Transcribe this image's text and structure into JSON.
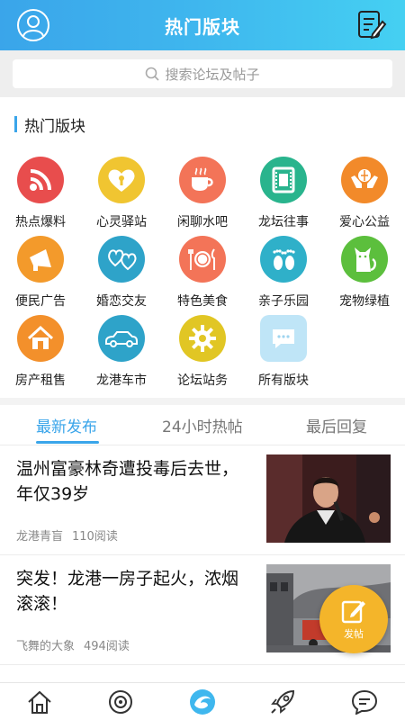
{
  "header": {
    "title": "热门版块",
    "avatar_icon": "user-avatar-icon",
    "compose_icon": "edit-note-icon"
  },
  "search": {
    "placeholder": "搜索论坛及帖子"
  },
  "section": {
    "title": "热门版块"
  },
  "boards": [
    {
      "label": "热点爆料",
      "icon": "rss-icon",
      "color": "#e84d4d"
    },
    {
      "label": "心灵驿站",
      "icon": "heart-lock-icon",
      "color": "#f0c531"
    },
    {
      "label": "闲聊水吧",
      "icon": "coffee-cup-icon",
      "color": "#f37458"
    },
    {
      "label": "龙坛往事",
      "icon": "film-archive-icon",
      "color": "#29b48d"
    },
    {
      "label": "爱心公益",
      "icon": "hands-globe-icon",
      "color": "#f28a2a"
    },
    {
      "label": "便民广告",
      "icon": "megaphone-icon",
      "color": "#f39a2b"
    },
    {
      "label": "婚恋交友",
      "icon": "hearts-icon",
      "color": "#2ea3c9"
    },
    {
      "label": "特色美食",
      "icon": "dining-plate-icon",
      "color": "#f37458"
    },
    {
      "label": "亲子乐园",
      "icon": "footprints-icon",
      "color": "#2fb0c9"
    },
    {
      "label": "宠物绿植",
      "icon": "cat-icon",
      "color": "#5cbf3d"
    },
    {
      "label": "房产租售",
      "icon": "house-icon",
      "color": "#f3902b"
    },
    {
      "label": "龙港车市",
      "icon": "car-icon",
      "color": "#2ea3c9"
    },
    {
      "label": "论坛站务",
      "icon": "gear-icon",
      "color": "#e1c624"
    },
    {
      "label": "所有版块",
      "icon": "chat-bubble-icon",
      "color": "#bfe5f7"
    }
  ],
  "tabs": [
    {
      "label": "最新发布",
      "active": true
    },
    {
      "label": "24小时热帖",
      "active": false
    },
    {
      "label": "最后回复",
      "active": false
    }
  ],
  "posts": [
    {
      "title": "温州富豪林奇遭投毒后去世，年仅39岁",
      "author": "龙港青盲",
      "views": "110阅读"
    },
    {
      "title": "突发！龙港一房子起火，浓烟滚滚！",
      "author": "飞舞的大象",
      "views": "494阅读"
    }
  ],
  "fab": {
    "label": "发帖"
  },
  "bottom_nav": [
    {
      "icon": "home-icon"
    },
    {
      "icon": "discover-icon"
    },
    {
      "icon": "dragon-logo-icon",
      "active": true
    },
    {
      "icon": "rocket-icon"
    },
    {
      "icon": "message-icon"
    }
  ],
  "colors": {
    "accent": "#3aa5ea",
    "fab": "#f4b52a"
  }
}
